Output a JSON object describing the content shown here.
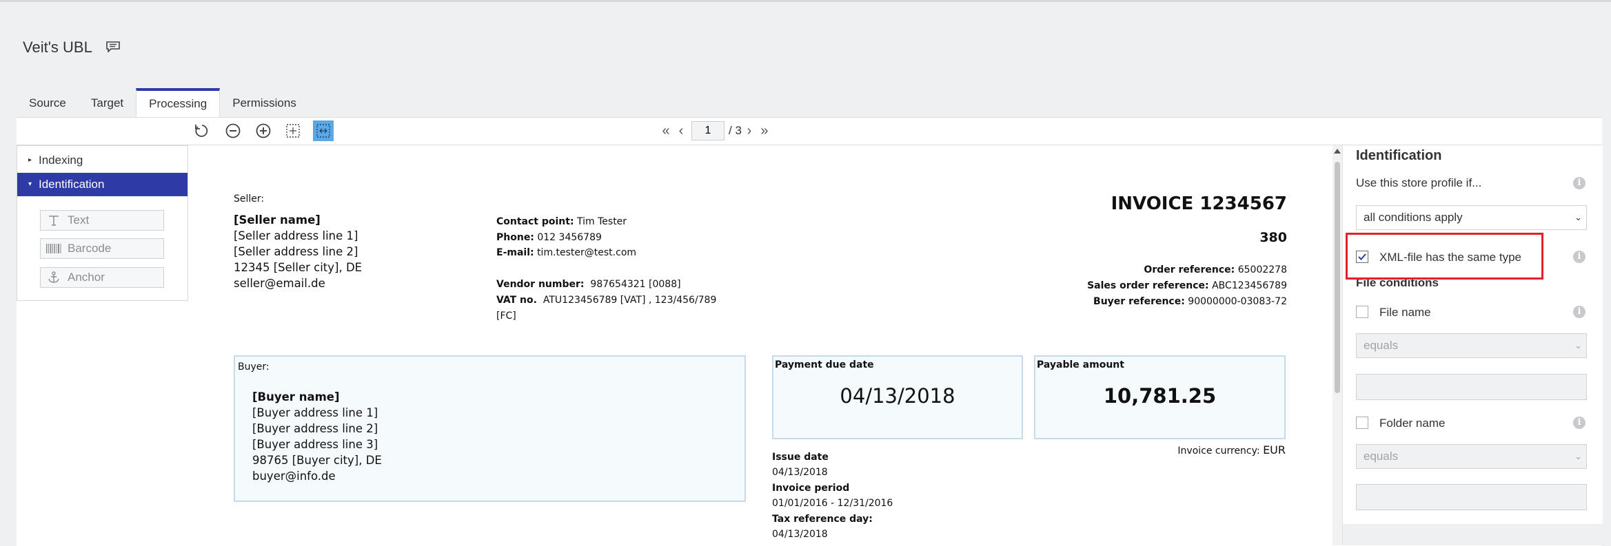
{
  "app": {
    "title": "Veit's UBL"
  },
  "tabs": [
    {
      "label": "Source",
      "active": false
    },
    {
      "label": "Target",
      "active": false
    },
    {
      "label": "Processing",
      "active": true
    },
    {
      "label": "Permissions",
      "active": false
    }
  ],
  "toolbar": {
    "icons": [
      "reset-icon",
      "zoom-out-icon",
      "zoom-in-icon",
      "fit-page-icon",
      "fit-width-icon"
    ],
    "active_icon": "fit-width-icon",
    "page_current": "1",
    "page_total": "/ 3"
  },
  "left_panel": {
    "items": [
      {
        "label": "Indexing",
        "selected": false
      },
      {
        "label": "Identification",
        "selected": true
      }
    ],
    "tools": [
      {
        "label": "Text",
        "icon": "text-icon"
      },
      {
        "label": "Barcode",
        "icon": "barcode-icon"
      },
      {
        "label": "Anchor",
        "icon": "anchor-icon"
      }
    ]
  },
  "document": {
    "seller_label": "Seller:",
    "seller_name": "[Seller name]",
    "seller_address_1": "[Seller address line 1]",
    "seller_address_2": "[Seller address line 2]",
    "seller_city": "12345  [Seller city], DE",
    "seller_email": "seller@email.de",
    "contact_label": "Contact point:",
    "contact_value": "Tim Tester",
    "phone_label": "Phone:",
    "phone_value": "012 3456789",
    "email_label": "E-mail:",
    "email_value": "tim.tester@test.com",
    "vendor_label": "Vendor number:",
    "vendor_value": "987654321  [0088]",
    "vat_label": "VAT no.",
    "vat_value": "ATU123456789   [VAT] ,  123/456/789",
    "vat_suffix": "[FC]",
    "invoice_title": "INVOICE  1234567",
    "invoice_type": "380",
    "order_ref_label": "Order reference:",
    "order_ref_value": "65002278",
    "sales_ref_label": "Sales order reference:",
    "sales_ref_value": "ABC123456789",
    "buyer_ref_label": "Buyer reference:",
    "buyer_ref_value": "90000000-03083-72",
    "buyer_label": "Buyer:",
    "buyer_name": "[Buyer name]",
    "buyer_address_1": "[Buyer address line 1]",
    "buyer_address_2": "[Buyer address line 2]",
    "buyer_address_3": "[Buyer address line 3]",
    "buyer_city": "98765  [Buyer city],  DE",
    "buyer_email": "buyer@info.de",
    "payment_due_label": "Payment due date",
    "payment_due_value": "04/13/2018",
    "payable_label": "Payable amount",
    "payable_value": "10,781.25",
    "currency_label": "Invoice currency:",
    "currency_value": "EUR",
    "issue_date_label": "Issue date",
    "issue_date_value": "04/13/2018",
    "invoice_period_label": "Invoice period",
    "invoice_period_value": "01/01/2016 - 12/31/2016",
    "tax_ref_label": "Tax reference day:",
    "tax_ref_value": "04/13/2018"
  },
  "right_panel": {
    "title": "Identification",
    "use_profile_label": "Use this store profile if...",
    "conditions_select": "all conditions apply",
    "xml_same_type_label": "XML-file has the same type",
    "xml_same_type_checked": true,
    "file_conditions_label": "File conditions",
    "file_name_label": "File name",
    "file_name_checked": false,
    "file_name_operator": "equals",
    "file_name_value": "",
    "folder_name_label": "Folder name",
    "folder_name_checked": false,
    "folder_name_operator": "equals",
    "folder_name_value": ""
  },
  "colors": {
    "accent": "#2e3aa6",
    "highlight_border": "#e3202a",
    "active_tool": "#5aa9e6",
    "doc_box_border": "#c5dbe8"
  }
}
